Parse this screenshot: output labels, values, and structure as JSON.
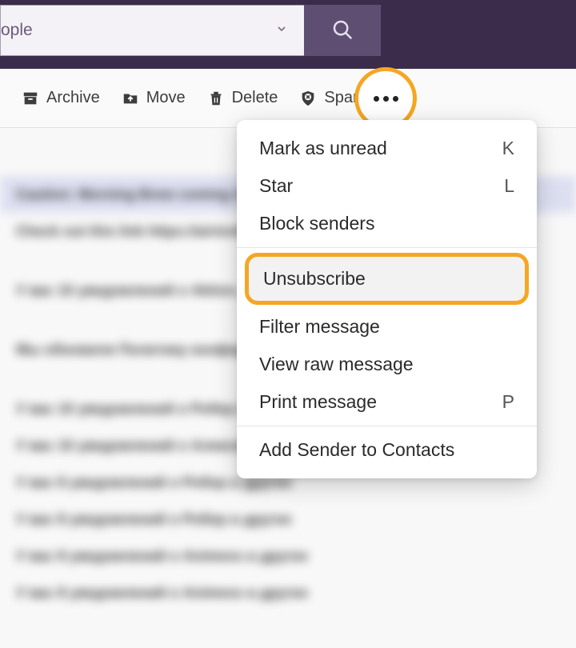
{
  "search": {
    "value": "ople",
    "placeholder": ""
  },
  "toolbar": {
    "archive": "Archive",
    "move": "Move",
    "delete": "Delete",
    "spam": "Spam"
  },
  "menu": {
    "mark_unread": {
      "label": "Mark as unread",
      "shortcut": "K"
    },
    "star": {
      "label": "Star",
      "shortcut": "L"
    },
    "block_senders": {
      "label": "Block senders"
    },
    "unsubscribe": {
      "label": "Unsubscribe"
    },
    "filter_message": {
      "label": "Filter message"
    },
    "view_raw": {
      "label": "View raw message"
    },
    "print": {
      "label": "Print message",
      "shortcut": "P"
    },
    "add_contact": {
      "label": "Add Sender to Contacts"
    }
  },
  "blur_rows": [
    "Caution: Morning Brew coming in",
    "Check out this link   https://airinvite...",
    "У вас 10 уведомлений о Aktion...",
    "Мы обновили Политику конфиден...",
    "У вас 10 уведомлений о Робер и других",
    "У вас 10 уведомлений о Алексей...",
    "У вас 8 уведомлений о Робер и других",
    "У вас 8 уведомлений о Робер и других",
    "У вас 8 уведомлений о Animess и других",
    "У вас 8 уведомлений о Animess и других"
  ]
}
